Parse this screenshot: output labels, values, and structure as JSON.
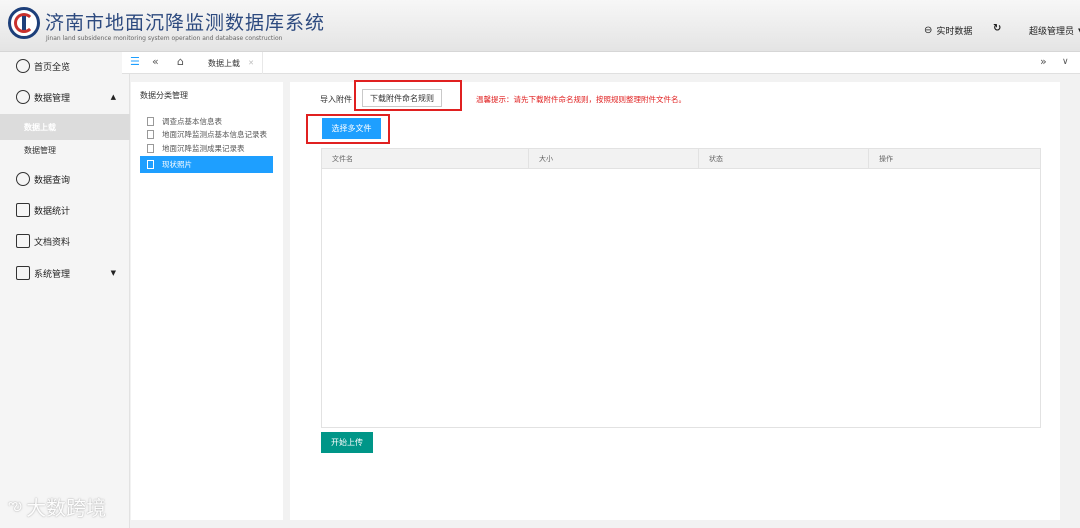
{
  "app": {
    "title": "济南市地面沉降监测数据库系统",
    "subtitle": "Jinan land subsidence monitoring system operation and database construction"
  },
  "header": {
    "realtime_label": "实时数据",
    "realtime_icon": "realtime-icon",
    "refresh_icon": "refresh-icon",
    "user_label": "超级管理员"
  },
  "sidebar": {
    "items": [
      {
        "label": "首页全览",
        "icon": "home-icon"
      },
      {
        "label": "数据管理",
        "icon": "data-management-icon",
        "expanded": true
      },
      {
        "label": "数据上载",
        "sub": true,
        "active": true
      },
      {
        "label": "数据管理",
        "sub": true
      },
      {
        "label": "数据查询",
        "icon": "query-icon"
      },
      {
        "label": "数据统计",
        "icon": "statistics-icon"
      },
      {
        "label": "文档资料",
        "icon": "document-icon"
      },
      {
        "label": "系统管理",
        "icon": "system-icon",
        "expanded": false
      }
    ]
  },
  "tabbar": {
    "active_tab": "数据上载"
  },
  "category_panel": {
    "title": "数据分类管理",
    "items": [
      {
        "label": "调查点基本信息表",
        "active": false
      },
      {
        "label": "地面沉降监测点基本信息记录表",
        "active": false
      },
      {
        "label": "地面沉降监测成果记录表",
        "active": false
      },
      {
        "label": "现状照片",
        "active": true
      }
    ]
  },
  "main": {
    "import_label": "导入附件",
    "download_button": "下载附件命名规则",
    "tip": "温馨提示：请先下载附件命名规则，按照规则整理附件文件名。",
    "select_button": "选择多文件",
    "table_headers": [
      "文件名",
      "大小",
      "状态",
      "操作"
    ],
    "start_button": "开始上传"
  },
  "watermark": "大数跨境",
  "colors": {
    "primary_blue": "#1e9fff",
    "teal": "#009688",
    "highlight_red": "#e02020",
    "title_blue": "#2d4a7f"
  }
}
